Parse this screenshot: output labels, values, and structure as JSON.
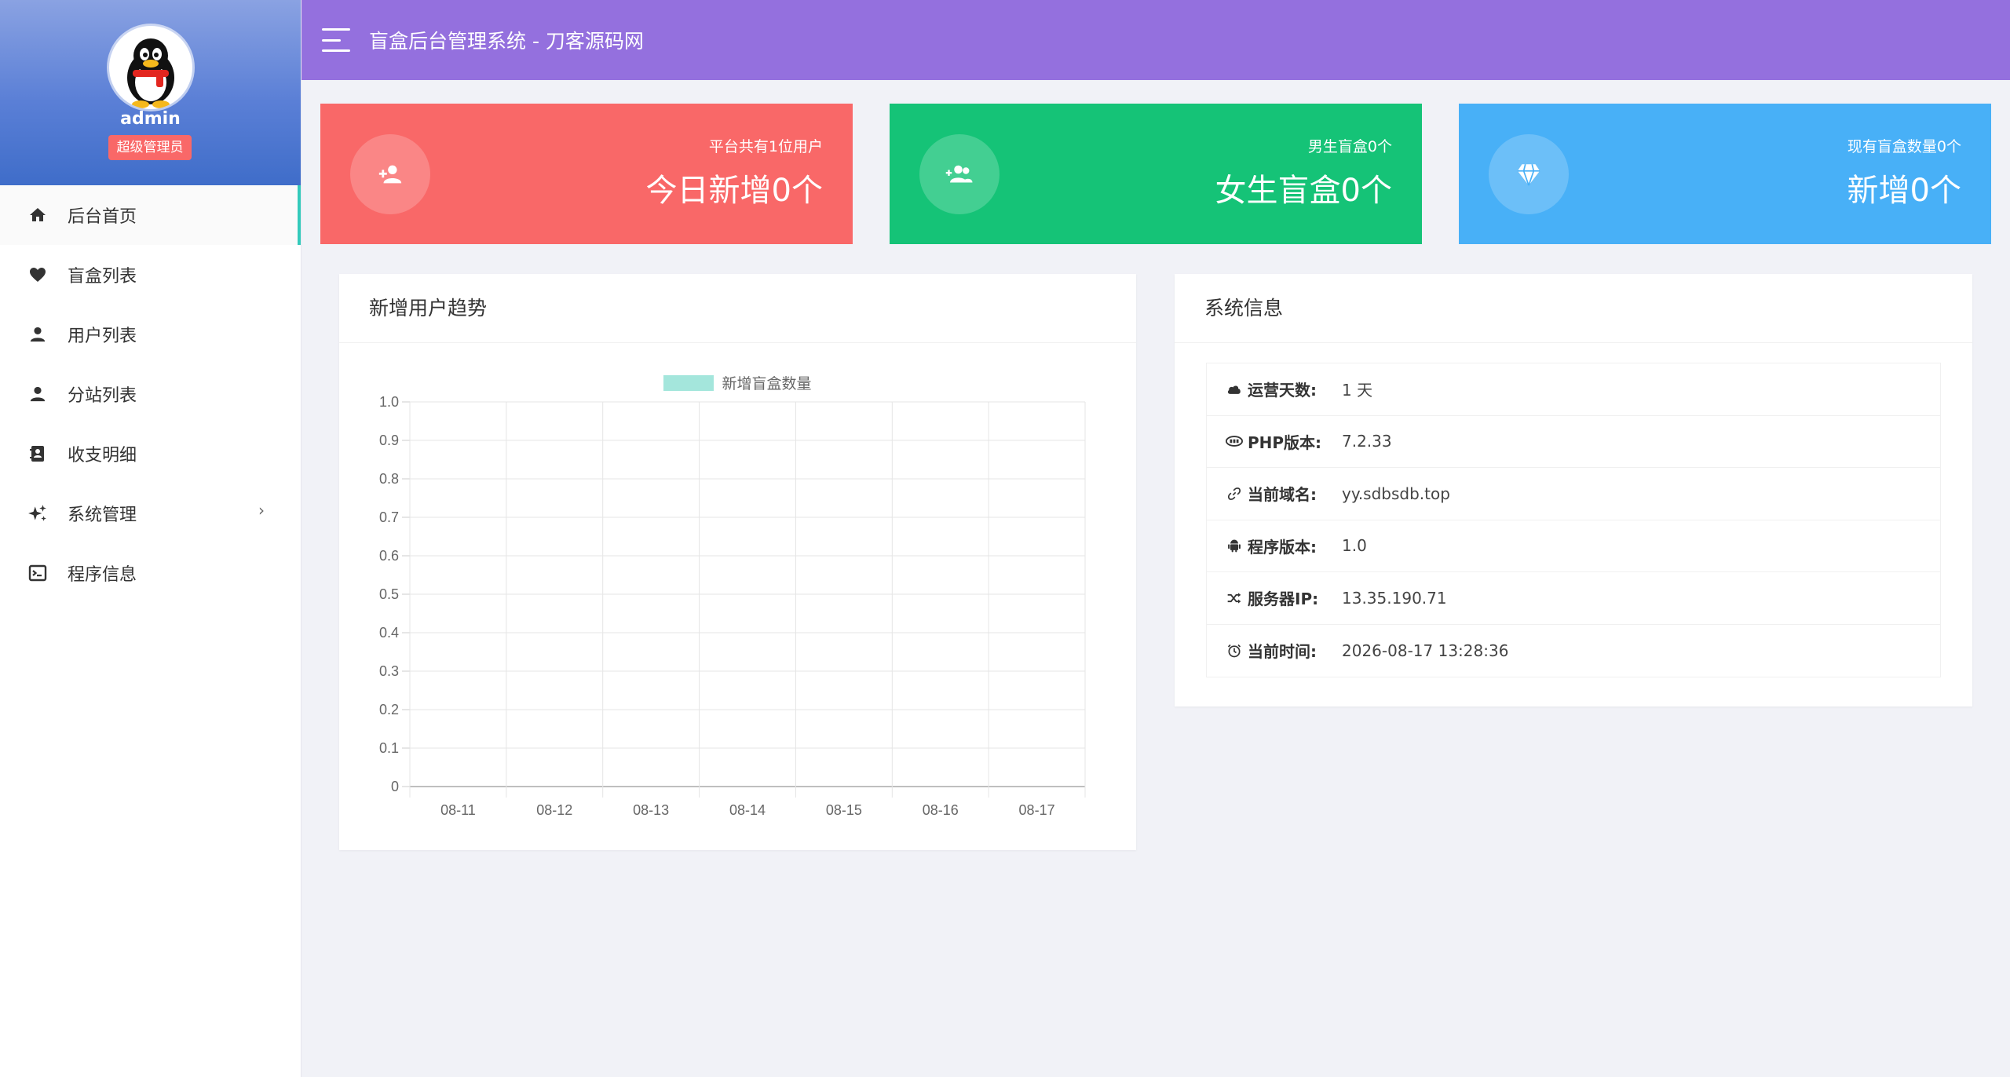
{
  "sidebar": {
    "admin_name": "admin",
    "role_badge": "超级管理员",
    "items": [
      {
        "label": "后台首页",
        "icon": "home-icon"
      },
      {
        "label": "盲盒列表",
        "icon": "heart-icon"
      },
      {
        "label": "用户列表",
        "icon": "user-icon"
      },
      {
        "label": "分站列表",
        "icon": "user-icon"
      },
      {
        "label": "收支明细",
        "icon": "contact-book-icon"
      },
      {
        "label": "系统管理",
        "icon": "sparkle-icon"
      },
      {
        "label": "程序信息",
        "icon": "terminal-icon"
      }
    ],
    "expand_glyph": "›"
  },
  "header": {
    "title": "盲盒后台管理系统 - 刀客源码网"
  },
  "stats": [
    {
      "sub": "平台共有1位用户",
      "big": "今日新增0个",
      "color": "#f96868",
      "icon": "user-plus-icon"
    },
    {
      "sub": "男生盲盒0个",
      "big": "女生盲盒0个",
      "color": "#15c377",
      "icon": "users-add-icon"
    },
    {
      "sub": "现有盲盒数量0个",
      "big": "新增0个",
      "color": "#48b0f7",
      "icon": "diamond-icon"
    }
  ],
  "chart_panel": {
    "title": "新增用户趋势"
  },
  "chart_data": {
    "type": "bar",
    "categories": [
      "08-11",
      "08-12",
      "08-13",
      "08-14",
      "08-15",
      "08-16",
      "08-17"
    ],
    "series": [
      {
        "name": "新增盲盒数量",
        "values": [
          0,
          0,
          0,
          0,
          0,
          0,
          0
        ],
        "color": "#a4e6dc"
      }
    ],
    "yticks": [
      "0",
      "0.1",
      "0.2",
      "0.3",
      "0.4",
      "0.5",
      "0.6",
      "0.7",
      "0.8",
      "0.9",
      "1.0"
    ],
    "ylim": [
      0,
      1.0
    ],
    "grid": true,
    "legend": "top"
  },
  "sysinfo": {
    "title": "系统信息",
    "rows": [
      {
        "label": "运营天数:",
        "value": "1 天",
        "icon": "cloud-icon"
      },
      {
        "label": "PHP版本:",
        "value": "7.2.33",
        "icon": "php-icon"
      },
      {
        "label": "当前域名:",
        "value": "yy.sdbsdb.top",
        "icon": "link-icon"
      },
      {
        "label": "程序版本:",
        "value": "1.0",
        "icon": "android-icon"
      },
      {
        "label": "服务器IP:",
        "value": "13.35.190.71",
        "icon": "shuffle-icon"
      },
      {
        "label": "当前时间:",
        "value": "2026-08-17 13:28:36",
        "icon": "clock-icon"
      }
    ]
  }
}
